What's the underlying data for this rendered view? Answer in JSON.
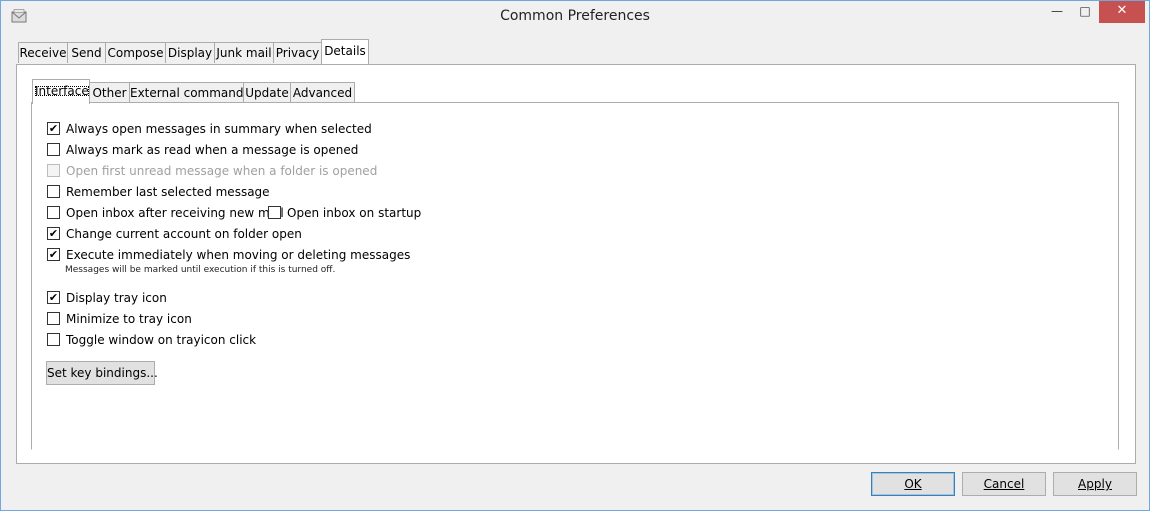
{
  "window": {
    "title": "Common Preferences",
    "minimize_icon": "minimize-icon",
    "maximize_icon": "maximize-icon",
    "close_icon": "close-icon"
  },
  "outer_tabs": [
    "Receive",
    "Send",
    "Compose",
    "Display",
    "Junk mail",
    "Privacy",
    "Details"
  ],
  "outer_tab_selected": "Details",
  "inner_tabs": [
    "Interface",
    "Other",
    "External commands",
    "Update",
    "Advanced"
  ],
  "inner_tab_selected": "Interface",
  "options": {
    "always_open_summary": {
      "label": "Always open messages in summary when selected",
      "checked": true
    },
    "always_mark_read": {
      "label": "Always mark as read when a message is opened",
      "checked": false
    },
    "open_first_unread": {
      "label": "Open first unread message when a folder is opened",
      "checked": false,
      "disabled": true
    },
    "remember_last": {
      "label": "Remember last selected message",
      "checked": false
    },
    "open_inbox_after_receive": {
      "label": "Open inbox after receiving new mail",
      "checked": false
    },
    "open_inbox_startup": {
      "label": "Open inbox on startup",
      "checked": false
    },
    "change_account": {
      "label": "Change current account on folder open",
      "checked": true
    },
    "execute_immediately": {
      "label": "Execute immediately when moving or deleting messages",
      "checked": true
    },
    "execute_note": "Messages will be marked until execution if this is turned off.",
    "display_tray": {
      "label": "Display tray icon",
      "checked": true
    },
    "minimize_tray": {
      "label": "Minimize to tray icon",
      "checked": false
    },
    "toggle_window": {
      "label": "Toggle window on trayicon click",
      "checked": false
    }
  },
  "key_bindings_button": "Set key bindings...",
  "footer": {
    "ok": "OK",
    "cancel": "Cancel",
    "apply": "Apply"
  },
  "colors": {
    "close_button": "#c75050",
    "accent_border": "#3c7fb1"
  }
}
